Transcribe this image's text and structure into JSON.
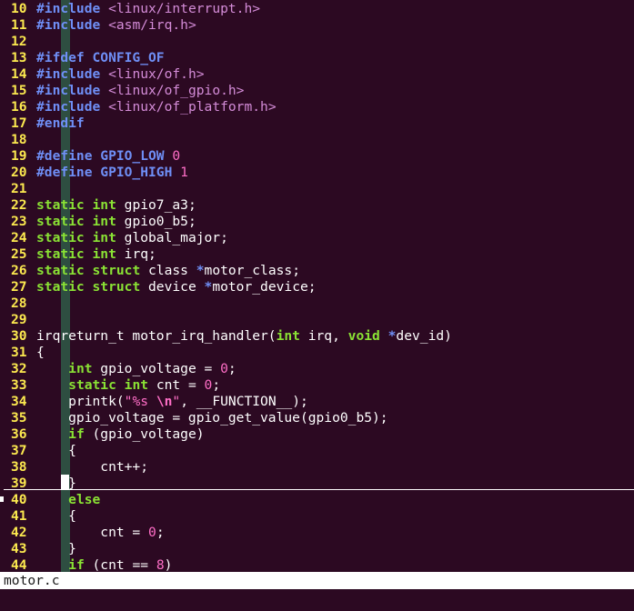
{
  "editor": {
    "file_name": "motor.c",
    "colors": {
      "background": "#2c0922",
      "line_number": "#fce94f",
      "preprocessor": "#6f8ff6",
      "include_path": "#d48cd8",
      "keyword": "#8ae234",
      "constant": "#ff6ec7",
      "text": "#ffffff",
      "status_bar_bg": "#ffffff"
    },
    "lines": [
      {
        "n": "10",
        "tokens": [
          [
            "pp",
            "#include"
          ],
          [
            "id",
            " "
          ],
          [
            "inc",
            "<linux/interrupt.h>"
          ]
        ]
      },
      {
        "n": "11",
        "tokens": [
          [
            "pp",
            "#include"
          ],
          [
            "id",
            " "
          ],
          [
            "inc",
            "<asm/irq.h>"
          ]
        ]
      },
      {
        "n": "12",
        "tokens": []
      },
      {
        "n": "13",
        "tokens": [
          [
            "pp",
            "#ifdef CONFIG_OF"
          ]
        ]
      },
      {
        "n": "14",
        "tokens": [
          [
            "pp",
            "#include"
          ],
          [
            "id",
            " "
          ],
          [
            "inc",
            "<linux/of.h>"
          ]
        ]
      },
      {
        "n": "15",
        "tokens": [
          [
            "pp",
            "#include"
          ],
          [
            "id",
            " "
          ],
          [
            "inc",
            "<linux/of_gpio.h>"
          ]
        ]
      },
      {
        "n": "16",
        "tokens": [
          [
            "pp",
            "#include"
          ],
          [
            "id",
            " "
          ],
          [
            "inc",
            "<linux/of_platform.h>"
          ]
        ]
      },
      {
        "n": "17",
        "tokens": [
          [
            "pp",
            "#endif"
          ]
        ]
      },
      {
        "n": "18",
        "tokens": []
      },
      {
        "n": "19",
        "tokens": [
          [
            "pp",
            "#define GPIO_LOW "
          ],
          [
            "num",
            "0"
          ]
        ]
      },
      {
        "n": "20",
        "tokens": [
          [
            "pp",
            "#define GPIO_HIGH "
          ],
          [
            "num",
            "1"
          ]
        ]
      },
      {
        "n": "21",
        "tokens": []
      },
      {
        "n": "22",
        "tokens": [
          [
            "kw",
            "static"
          ],
          [
            "id",
            " "
          ],
          [
            "kw",
            "int"
          ],
          [
            "id",
            " gpio7_a3;"
          ]
        ]
      },
      {
        "n": "23",
        "tokens": [
          [
            "kw",
            "static"
          ],
          [
            "id",
            " "
          ],
          [
            "kw",
            "int"
          ],
          [
            "id",
            " gpio0_b5;"
          ]
        ]
      },
      {
        "n": "24",
        "tokens": [
          [
            "kw",
            "static"
          ],
          [
            "id",
            " "
          ],
          [
            "kw",
            "int"
          ],
          [
            "id",
            " global_major;"
          ]
        ]
      },
      {
        "n": "25",
        "tokens": [
          [
            "kw",
            "static"
          ],
          [
            "id",
            " "
          ],
          [
            "kw",
            "int"
          ],
          [
            "id",
            " irq;"
          ]
        ]
      },
      {
        "n": "26",
        "tokens": [
          [
            "kw",
            "static"
          ],
          [
            "id",
            " "
          ],
          [
            "kw",
            "struct"
          ],
          [
            "id",
            " class "
          ],
          [
            "star",
            "*"
          ],
          [
            "id",
            "motor_class;"
          ]
        ]
      },
      {
        "n": "27",
        "tokens": [
          [
            "kw",
            "static"
          ],
          [
            "id",
            " "
          ],
          [
            "kw",
            "struct"
          ],
          [
            "id",
            " device "
          ],
          [
            "star",
            "*"
          ],
          [
            "id",
            "motor_device;"
          ]
        ]
      },
      {
        "n": "28",
        "tokens": []
      },
      {
        "n": "29",
        "tokens": []
      },
      {
        "n": "30",
        "tokens": [
          [
            "id",
            "irqreturn_t motor_irq_handler("
          ],
          [
            "kw",
            "int"
          ],
          [
            "id",
            " irq, "
          ],
          [
            "kw",
            "void"
          ],
          [
            "id",
            " "
          ],
          [
            "star",
            "*"
          ],
          [
            "id",
            "dev_id)"
          ]
        ]
      },
      {
        "n": "31",
        "tokens": [
          [
            "id",
            "{"
          ]
        ]
      },
      {
        "n": "32",
        "tokens": [
          [
            "id",
            "    "
          ],
          [
            "kw",
            "int"
          ],
          [
            "id",
            " gpio_voltage = "
          ],
          [
            "num",
            "0"
          ],
          [
            "id",
            ";"
          ]
        ]
      },
      {
        "n": "33",
        "tokens": [
          [
            "id",
            "    "
          ],
          [
            "kw",
            "static"
          ],
          [
            "id",
            " "
          ],
          [
            "kw",
            "int"
          ],
          [
            "id",
            " cnt = "
          ],
          [
            "num",
            "0"
          ],
          [
            "id",
            ";"
          ]
        ]
      },
      {
        "n": "34",
        "tokens": [
          [
            "id",
            "    printk("
          ],
          [
            "str",
            "\"%s "
          ],
          [
            "esc",
            "\\n"
          ],
          [
            "str",
            "\""
          ],
          [
            "id",
            ", __FUNCTION__);"
          ]
        ]
      },
      {
        "n": "35",
        "tokens": [
          [
            "id",
            "    gpio_voltage = gpio_get_value(gpio0_b5);"
          ]
        ]
      },
      {
        "n": "36",
        "tokens": [
          [
            "id",
            "    "
          ],
          [
            "kw",
            "if"
          ],
          [
            "id",
            " (gpio_voltage)"
          ]
        ]
      },
      {
        "n": "37",
        "tokens": [
          [
            "id",
            "    {"
          ]
        ]
      },
      {
        "n": "38",
        "tokens": [
          [
            "id",
            "        cnt++;"
          ]
        ]
      },
      {
        "n": "39",
        "tokens": [
          [
            "id",
            "    }"
          ]
        ]
      },
      {
        "n": "40",
        "tokens": [
          [
            "id",
            "    "
          ],
          [
            "kw",
            "else"
          ]
        ]
      },
      {
        "n": "41",
        "tokens": [
          [
            "id",
            "    {"
          ]
        ]
      },
      {
        "n": "42",
        "tokens": [
          [
            "id",
            "        cnt = "
          ],
          [
            "num",
            "0"
          ],
          [
            "id",
            ";"
          ]
        ]
      },
      {
        "n": "43",
        "tokens": [
          [
            "id",
            "    }"
          ]
        ]
      },
      {
        "n": "44",
        "tokens": [
          [
            "id",
            "    "
          ],
          [
            "kw",
            "if"
          ],
          [
            "id",
            " (cnt == "
          ],
          [
            "num",
            "8"
          ],
          [
            "id",
            ")"
          ]
        ]
      }
    ]
  }
}
